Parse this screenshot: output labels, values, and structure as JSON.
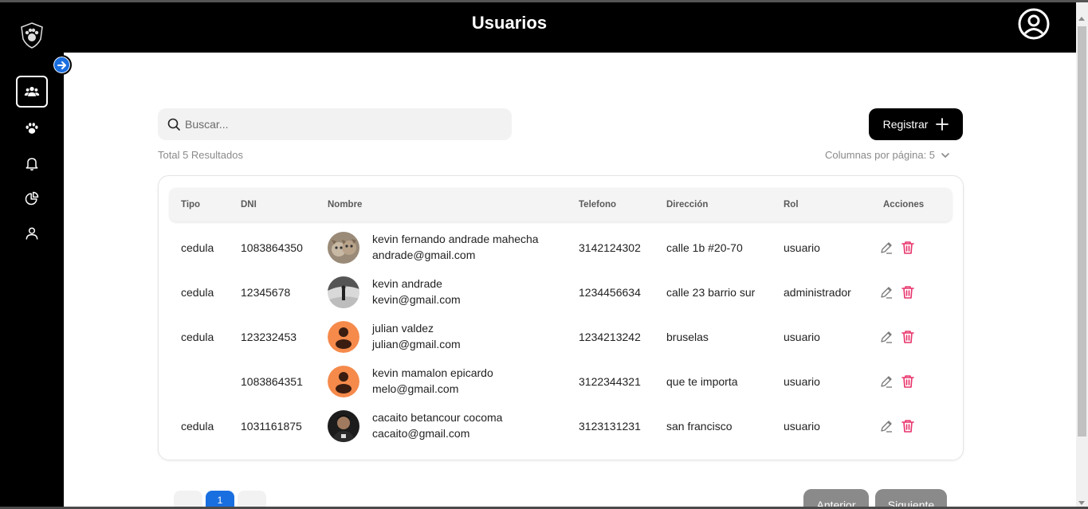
{
  "header": {
    "title": "Usuarios"
  },
  "search": {
    "placeholder": "Buscar..."
  },
  "actions": {
    "register_label": "Registrar"
  },
  "summary": {
    "total": "Total 5 Resultados",
    "per_page": "Columnas por página: 5"
  },
  "table": {
    "headers": [
      "Tipo",
      "DNI",
      "Nombre",
      "Telefono",
      "Dirección",
      "Rol",
      "Acciones"
    ],
    "rows": [
      {
        "tipo": "cedula",
        "dni": "1083864350",
        "name": "kevin fernando andrade mahecha",
        "email": "andrade@gmail.com",
        "telefono": "3142124302",
        "direccion": "calle 1b #20-70",
        "rol": "usuario"
      },
      {
        "tipo": "cedula",
        "dni": "12345678",
        "name": "kevin andrade",
        "email": "kevin@gmail.com",
        "telefono": "1234456634",
        "direccion": "calle 23 barrio sur",
        "rol": "administrador"
      },
      {
        "tipo": "cedula",
        "dni": "123232453",
        "name": "julian valdez",
        "email": "julian@gmail.com",
        "telefono": "1234213242",
        "direccion": "bruselas",
        "rol": "usuario"
      },
      {
        "tipo": "",
        "dni": "1083864351",
        "name": "kevin mamalon epicardo",
        "email": "melo@gmail.com",
        "telefono": "3122344321",
        "direccion": "que te importa",
        "rol": "usuario"
      },
      {
        "tipo": "cedula",
        "dni": "1031161875",
        "name": "cacaito betancour cocoma",
        "email": "cacaito@gmail.com",
        "telefono": "3123131231",
        "direccion": "san francisco",
        "rol": "usuario"
      }
    ]
  },
  "pagination": {
    "current": "1",
    "prev_label": "Anterior",
    "next_label": "Siguiente"
  },
  "colors": {
    "accent": "#1a6fe0",
    "delete": "#e8336b",
    "placeholder_avatar": "#f58a4b"
  },
  "icons": {
    "sidebar": [
      "users-icon",
      "paw-icon",
      "bell-icon",
      "pie-chart-icon",
      "user-icon"
    ],
    "header_logo": "paw-shield-logo-icon",
    "header_user": "user-circle-icon"
  }
}
